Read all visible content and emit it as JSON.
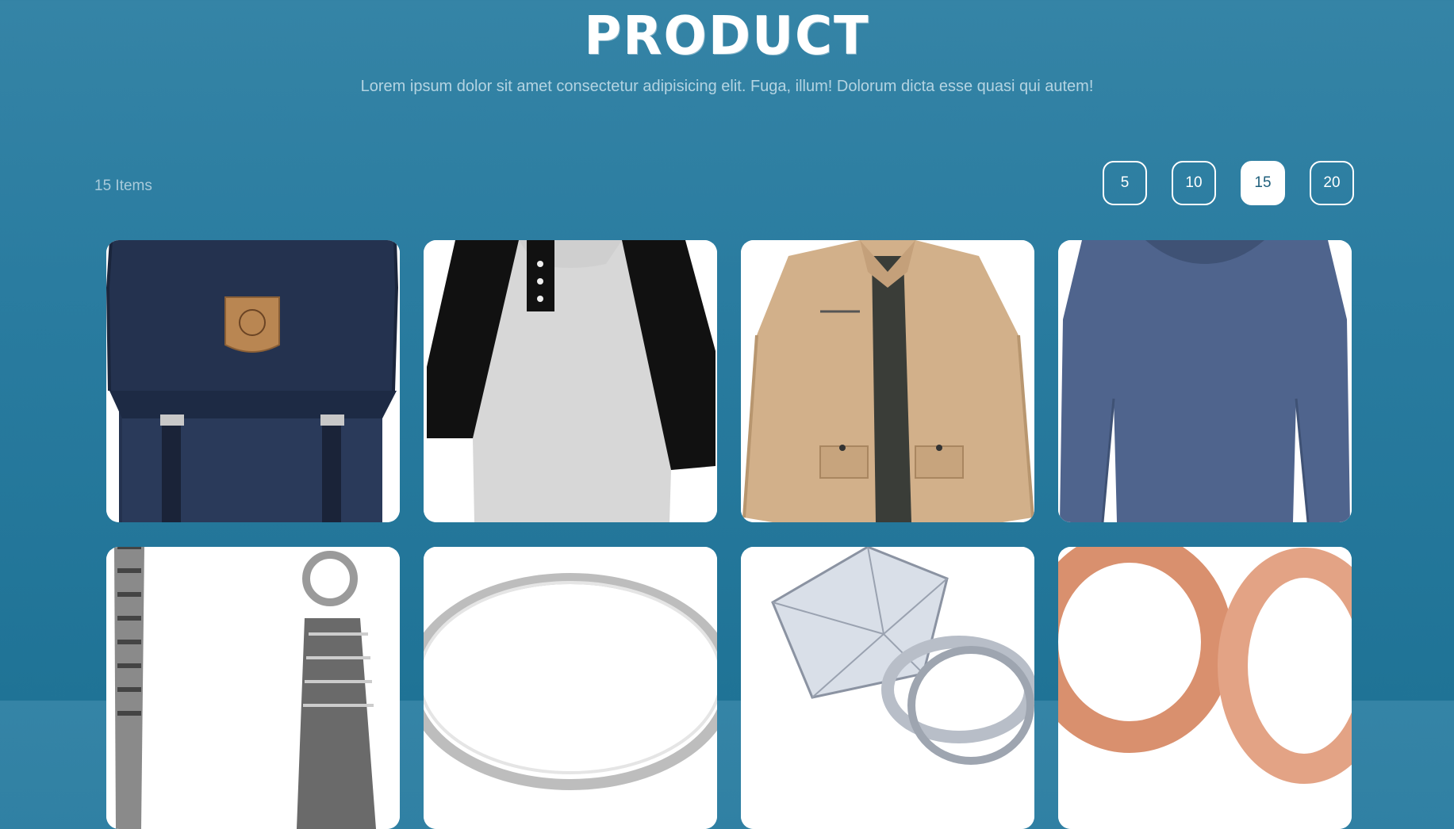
{
  "header": {
    "title": "PRODUCT",
    "subtitle": "Lorem ipsum dolor sit amet consectetur adipisicing elit. Fuga, illum! Dolorum dicta esse quasi qui autem!"
  },
  "toolbar": {
    "items_count": "15 Items",
    "page_sizes": [
      "5",
      "10",
      "15",
      "20"
    ],
    "active_page_size": "15"
  },
  "colors": {
    "background_top": "#3584a6",
    "background_bottom": "#1f7396",
    "accent": "#ffffff"
  },
  "products": [
    {
      "image": "navy-backpack"
    },
    {
      "image": "raglan-henley-shirt"
    },
    {
      "image": "khaki-jacket"
    },
    {
      "image": "blue-long-sleeve-shirt"
    },
    {
      "image": "silver-chain-bracelet"
    },
    {
      "image": "silver-ring"
    },
    {
      "image": "diamond-ring"
    },
    {
      "image": "rose-gold-rings"
    }
  ]
}
